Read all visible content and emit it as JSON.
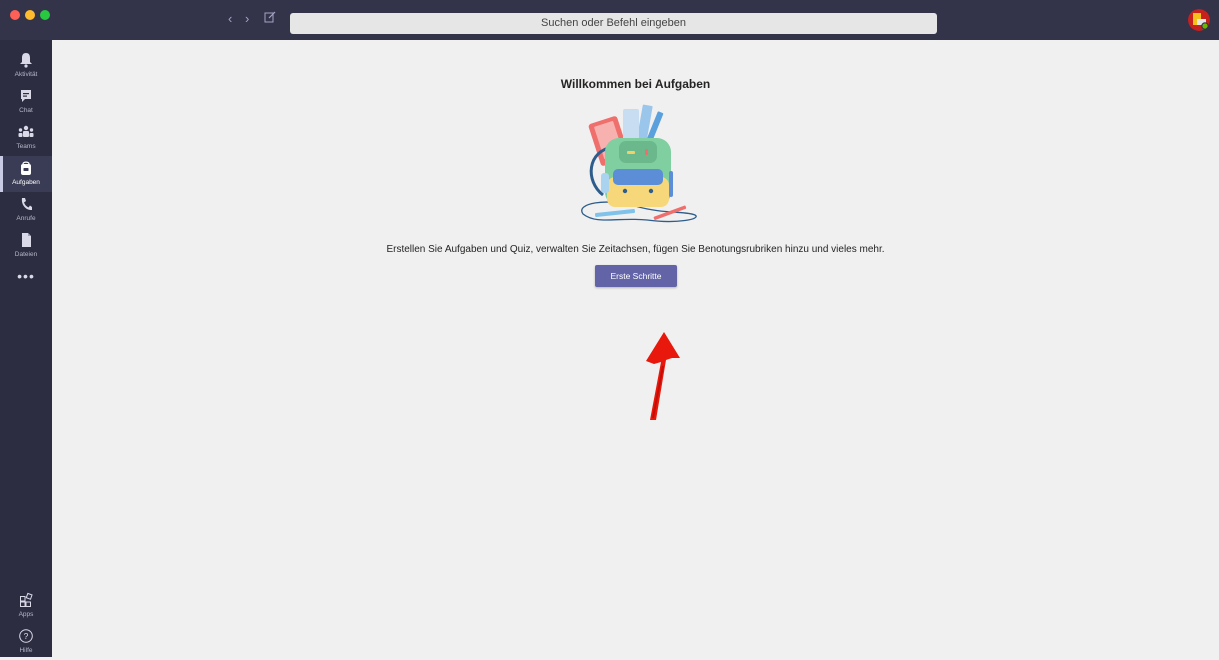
{
  "window": {
    "search_placeholder": "Suchen oder Befehl eingeben",
    "nav_back_icon": "chevron-left-icon",
    "nav_forward_icon": "chevron-right-icon",
    "compose_icon": "compose-icon"
  },
  "sidebar": {
    "items": [
      {
        "label": "Aktivität",
        "icon": "bell-icon"
      },
      {
        "label": "Chat",
        "icon": "chat-icon"
      },
      {
        "label": "Teams",
        "icon": "teams-icon"
      },
      {
        "label": "Aufgaben",
        "icon": "backpack-icon",
        "active": true
      },
      {
        "label": "Anrufe",
        "icon": "phone-icon"
      },
      {
        "label": "Dateien",
        "icon": "file-icon"
      },
      {
        "label": "",
        "icon": "more-icon"
      }
    ],
    "bottom": [
      {
        "label": "Apps",
        "icon": "apps-icon"
      },
      {
        "label": "Hilfe",
        "icon": "help-icon"
      }
    ]
  },
  "main": {
    "title": "Willkommen bei Aufgaben",
    "description": "Erstellen Sie Aufgaben und Quiz, verwalten Sie Zeitachsen, fügen Sie Benotungsrubriken hinzu und vieles mehr.",
    "button_label": "Erste Schritte"
  },
  "colors": {
    "titlebar": "#33344a",
    "rail": "#2c2d40",
    "accent": "#6264a7",
    "annotation_arrow": "#e8180c",
    "background": "#f0f0f0"
  }
}
